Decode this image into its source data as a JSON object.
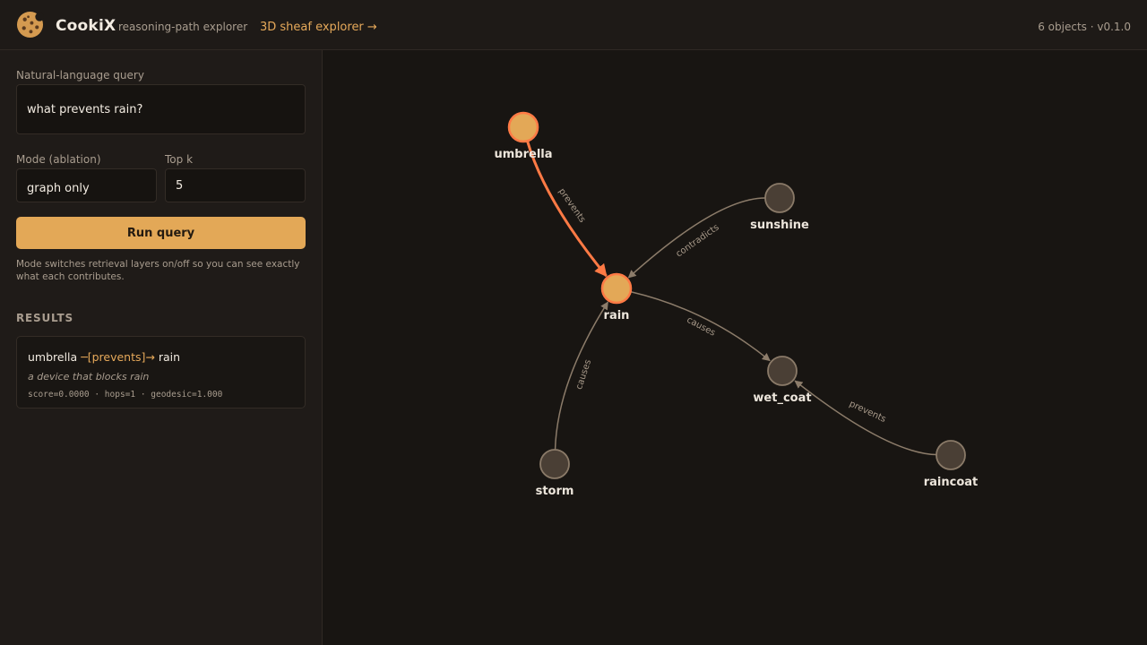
{
  "header": {
    "brand": "CookiX",
    "tagline": "reasoning-path explorer",
    "nav_link": "3D sheaf explorer →",
    "meta": "6 objects · v0.1.0"
  },
  "sidebar": {
    "query_label": "Natural-language query",
    "query_value": "what prevents rain?",
    "mode_label": "Mode (ablation)",
    "mode_value": "graph only",
    "topk_label": "Top k",
    "topk_value": "5",
    "run_label": "Run query",
    "help_text": "Mode switches retrieval layers on/off so you can see exactly what each contributes."
  },
  "results": {
    "heading": "RESULTS",
    "items": [
      {
        "subject": "umbrella",
        "relation": "─[prevents]→",
        "object": "rain",
        "definition": "a device that blocks rain",
        "score_line": "score=0.0000 · hops=1 · geodesic=1.000"
      }
    ]
  },
  "graph": {
    "nodes": [
      {
        "id": "umbrella",
        "label": "umbrella",
        "highlighted": true
      },
      {
        "id": "sunshine",
        "label": "sunshine",
        "highlighted": false
      },
      {
        "id": "rain",
        "label": "rain",
        "highlighted": true
      },
      {
        "id": "wet_coat",
        "label": "wet_coat",
        "highlighted": false
      },
      {
        "id": "storm",
        "label": "storm",
        "highlighted": false
      },
      {
        "id": "raincoat",
        "label": "raincoat",
        "highlighted": false
      }
    ],
    "edges": [
      {
        "source": "umbrella",
        "target": "rain",
        "label": "prevents",
        "highlighted": true
      },
      {
        "source": "sunshine",
        "target": "rain",
        "label": "contradicts",
        "highlighted": false
      },
      {
        "source": "storm",
        "target": "rain",
        "label": "causes",
        "highlighted": false
      },
      {
        "source": "rain",
        "target": "wet_coat",
        "label": "causes",
        "highlighted": false
      },
      {
        "source": "raincoat",
        "target": "wet_coat",
        "label": "prevents",
        "highlighted": false
      }
    ]
  },
  "colors": {
    "accent": "#e3a857",
    "highlight_edge": "#ff7a45",
    "node_default": "#4a3f35",
    "edge_default": "#8c7c6a"
  }
}
